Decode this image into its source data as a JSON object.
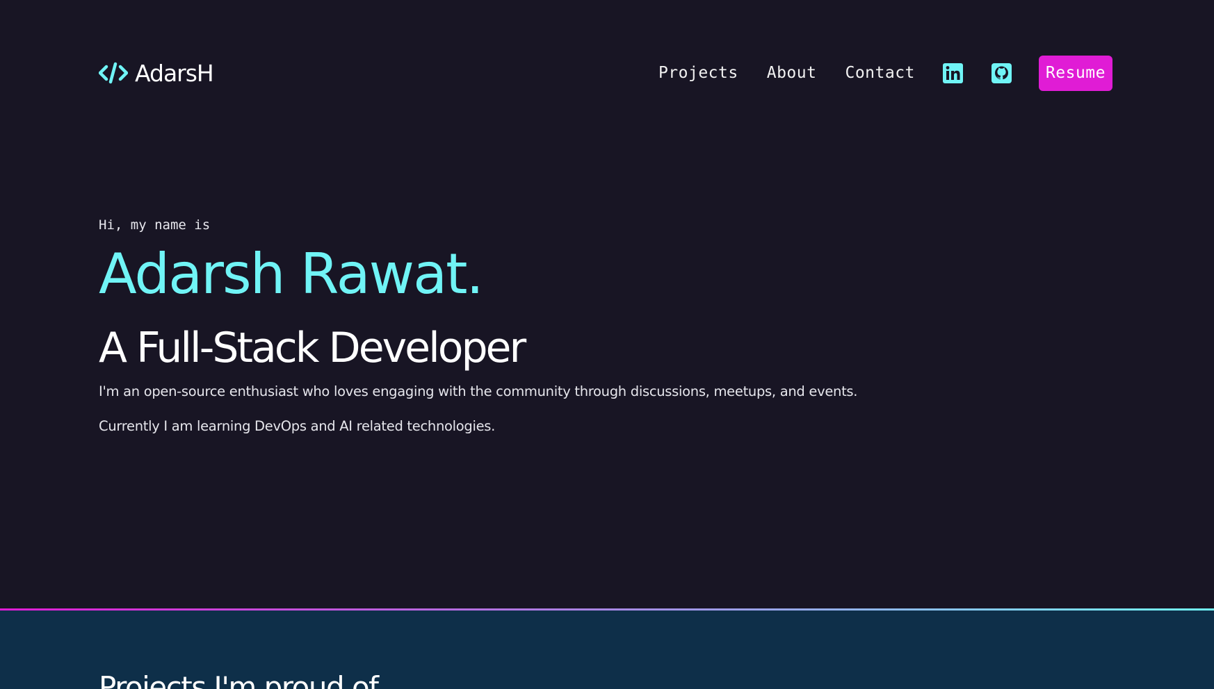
{
  "header": {
    "logo_text": "AdarsH",
    "logo_icon": "code-brackets-icon",
    "nav": {
      "projects": "Projects",
      "about": "About",
      "contact": "Contact"
    },
    "social": {
      "linkedin_icon": "linkedin-icon",
      "github_icon": "github-icon"
    },
    "resume_label": "Resume"
  },
  "hero": {
    "greeting": "Hi, my name is",
    "name": "Adarsh Rawat.",
    "role": "A Full-Stack Developer",
    "bio_1": "I'm an open-source enthusiast who loves engaging with the community through discussions, meetups, and events.",
    "bio_2": "Currently I am learning DevOps and AI related technologies."
  },
  "projects": {
    "title": "Projects I'm proud of"
  },
  "colors": {
    "background": "#181524",
    "accent_cyan": "#70f4f6",
    "accent_magenta": "#e01cd5",
    "section_background": "#0e2f49"
  }
}
